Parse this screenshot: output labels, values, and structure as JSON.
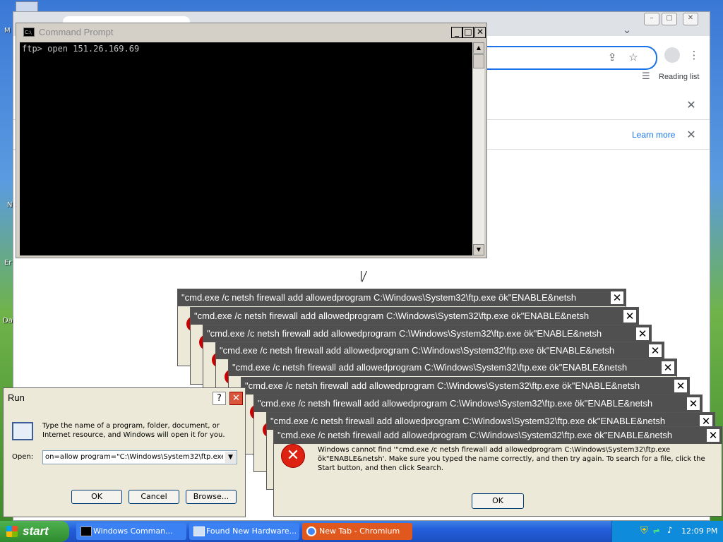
{
  "desktop": {
    "fragments": [
      "M",
      "N",
      "Er",
      "Da"
    ]
  },
  "chromium": {
    "window_controls": [
      "–",
      "▢",
      "✕"
    ],
    "reading_list_label": "Reading list",
    "infobar2_link": "Learn more",
    "close_glyph": "✕"
  },
  "cmd": {
    "title": "Command Prompt",
    "console_line": "ftp> open 151.26.169.69",
    "icon_text": "C:\\"
  },
  "errors": {
    "title": "\"cmd.exe /c netsh firewall add allowedprogram C:\\Windows\\System32\\ftp.exe ök\"ENABLE&netsh",
    "close_glyph": "✕",
    "message": "Windows cannot find '\"cmd.exe /c netsh firewall add allowedprogram C:\\Windows\\System32\\ftp.exe ök\"ENABLE&netsh'. Make sure you typed the name correctly, and then try again. To search for a file, click the Start button, and then click Search.",
    "ok_label": "OK"
  },
  "run": {
    "title": "Run",
    "help_glyph": "?",
    "close_glyph": "✕",
    "description": "Type the name of a program, folder, document, or Internet resource, and Windows will open it for you.",
    "open_label": "Open:",
    "open_value": "on=allow program=\"C:\\Windows\\System32\\ftp.exe",
    "ok_label": "OK",
    "cancel_label": "Cancel",
    "browse_label": "Browse..."
  },
  "taskbar": {
    "start_label": "start",
    "items": [
      {
        "label": "Windows Comman...",
        "icon": "cmd-icon"
      },
      {
        "label": "Found New Hardware...",
        "icon": "hardware-icon"
      },
      {
        "label": "New Tab - Chromium",
        "icon": "chromium-icon"
      }
    ],
    "clock": "12:09 PM"
  },
  "colors": {
    "error_title_bg": "#505050",
    "chrome_accent": "#1a73e8",
    "start_green": "#3c9a3c",
    "taskbar_blue": "#245edb"
  }
}
